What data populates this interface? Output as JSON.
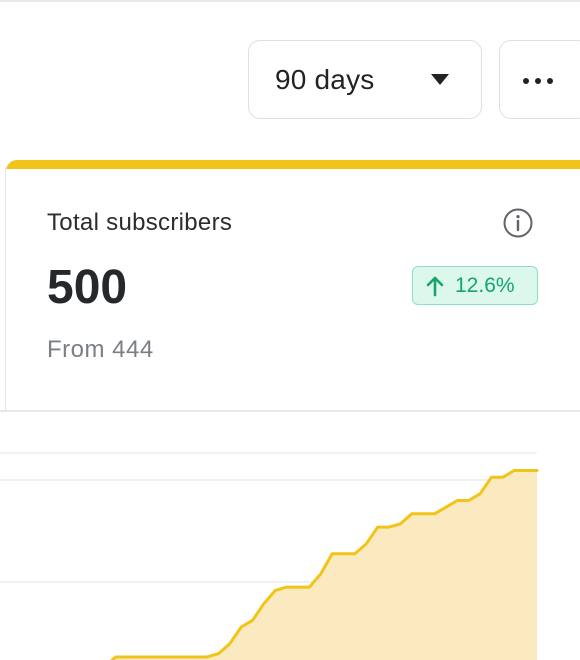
{
  "toolbar": {
    "range_label": "90 days",
    "more_icon": "more-horizontal-icon"
  },
  "metric": {
    "title": "Total subscribers",
    "value": "500",
    "change": "12.6%",
    "from_text": "From 444",
    "accent_color": "#f0c419",
    "positive_color": "#16a46b"
  },
  "chart_data": {
    "type": "area",
    "series": [
      {
        "values": [
          444,
          444,
          444,
          444,
          444,
          444,
          444,
          444,
          444,
          445,
          448,
          453,
          455,
          460,
          464,
          465,
          465,
          465,
          469,
          475,
          475,
          475,
          478,
          483,
          483,
          484,
          487,
          487,
          487,
          489,
          491,
          491,
          493,
          498,
          498,
          500,
          500,
          500
        ]
      }
    ],
    "color": "#f0c419",
    "fill": "#fbeac0",
    "grid": true
  }
}
